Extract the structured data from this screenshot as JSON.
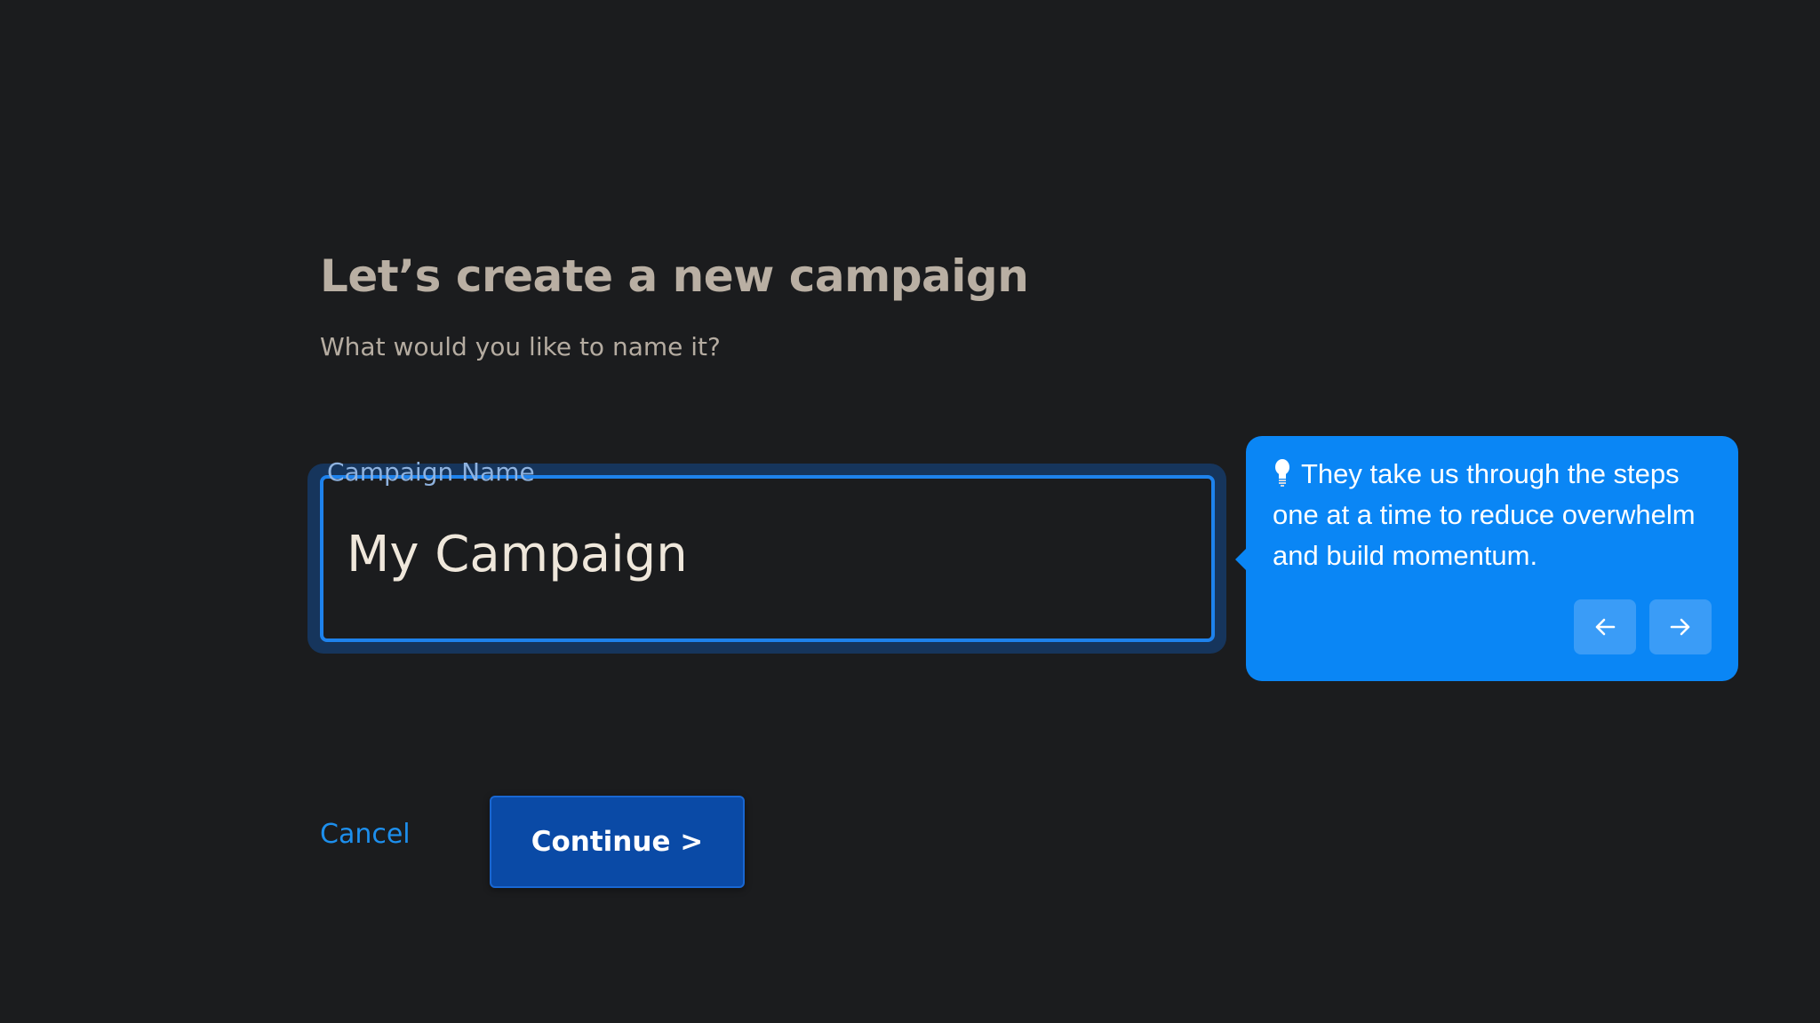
{
  "page": {
    "heading": "Let’s create a new campaign",
    "subheading": "What would you like to name it?"
  },
  "field": {
    "label": "Campaign Name",
    "value": "My Campaign"
  },
  "tip": {
    "icon": "lightbulb-icon",
    "text": "They take us through the steps one at a time to reduce overwhelm and build momentum.",
    "prev_icon": "arrow-left-icon",
    "next_icon": "arrow-right-icon"
  },
  "actions": {
    "cancel_label": "Cancel",
    "continue_label": "Continue >"
  },
  "colors": {
    "background": "#1b1c1e",
    "accent": "#0a86f5",
    "primary_button": "#0a4aa6",
    "field_border": "#1e82ec",
    "heading_text": "#b9afa3"
  }
}
